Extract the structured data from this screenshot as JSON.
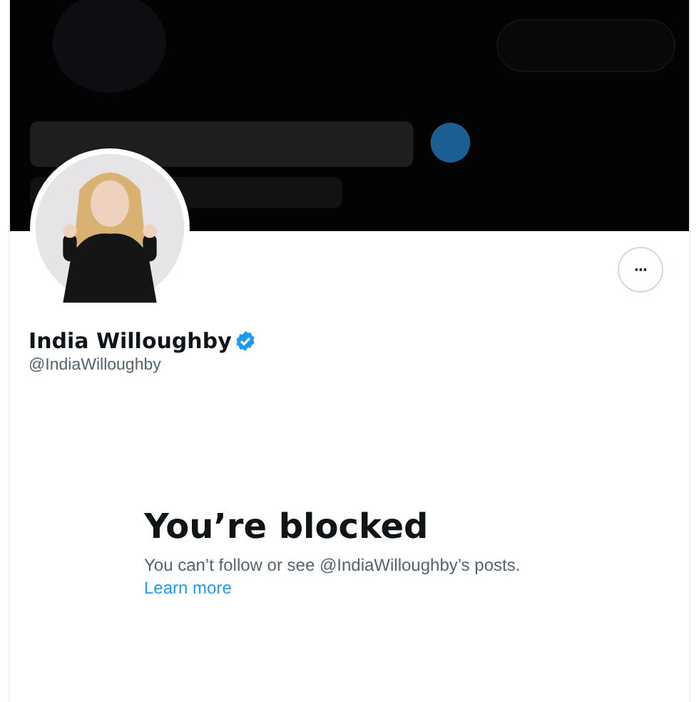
{
  "more_button": {
    "label": "···"
  },
  "profile": {
    "name": "India Willoughby",
    "verified": true,
    "handle": "@IndiaWilloughby"
  },
  "blocked": {
    "title": "You’re blocked",
    "message": "You can’t follow or see @IndiaWilloughby’s posts.",
    "link": "Learn more"
  }
}
